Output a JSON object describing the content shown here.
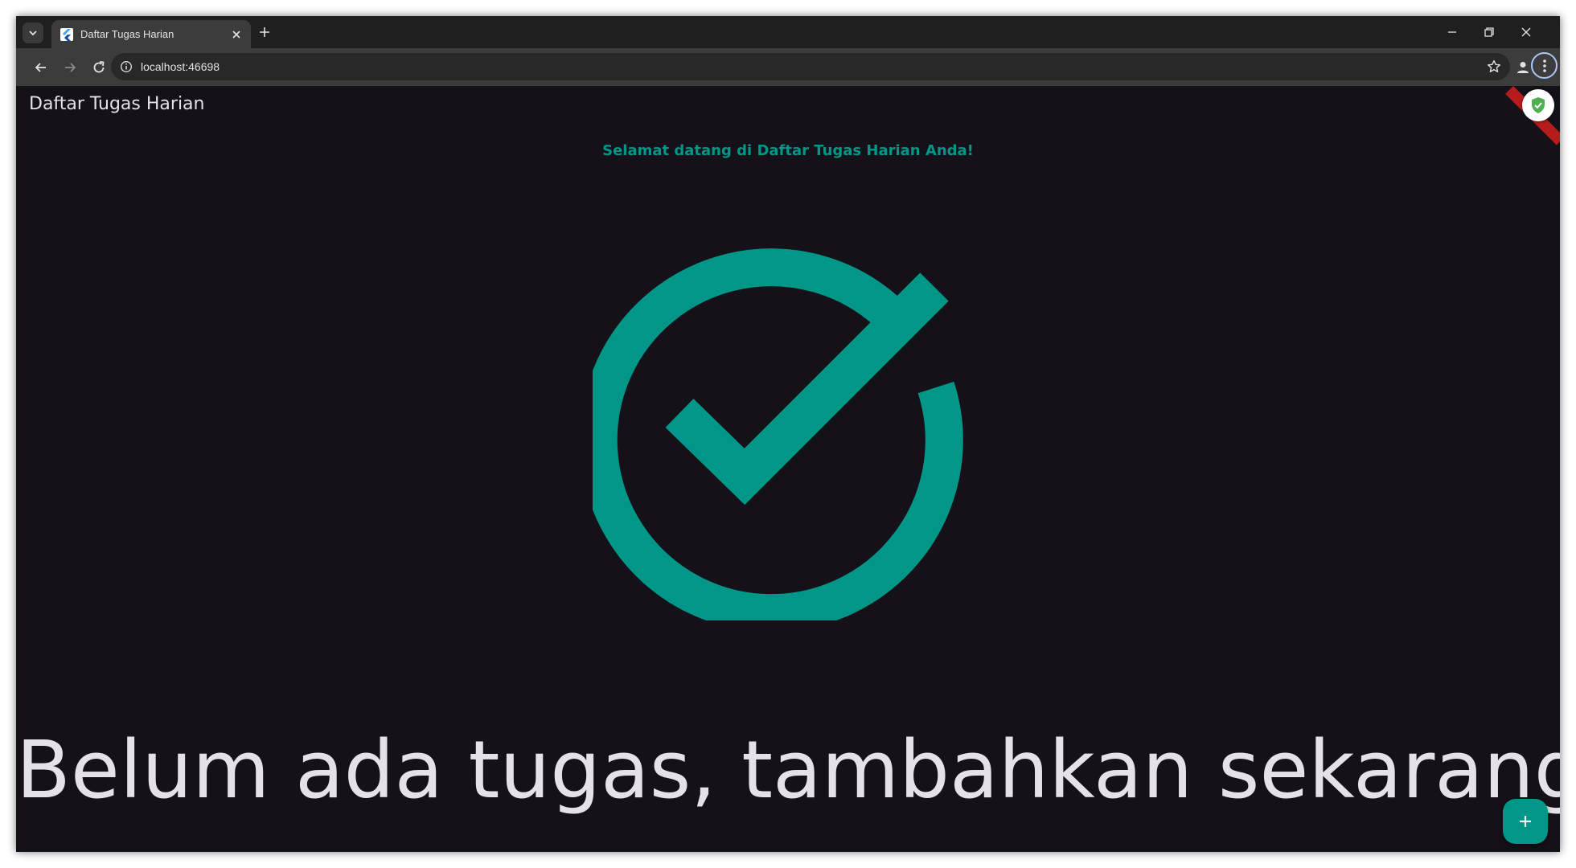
{
  "browser": {
    "tab_title": "Daftar Tugas Harian",
    "url": "localhost:46698"
  },
  "app": {
    "title": "Daftar Tugas Harian",
    "welcome_text": "Selamat datang di Daftar Tugas Harian Anda!",
    "empty_state_text": "Belum ada tugas, tambahkan sekarang!",
    "hero_icon": "check-circle-icon",
    "fab_icon": "add-icon",
    "extension_icon": "shield-check-icon"
  },
  "colors": {
    "accent": "#009688",
    "background": "#141218",
    "text": "#e6e0e9",
    "browser_dark": "#1f1f1f",
    "browser_toolbar": "#3c3c3c"
  }
}
